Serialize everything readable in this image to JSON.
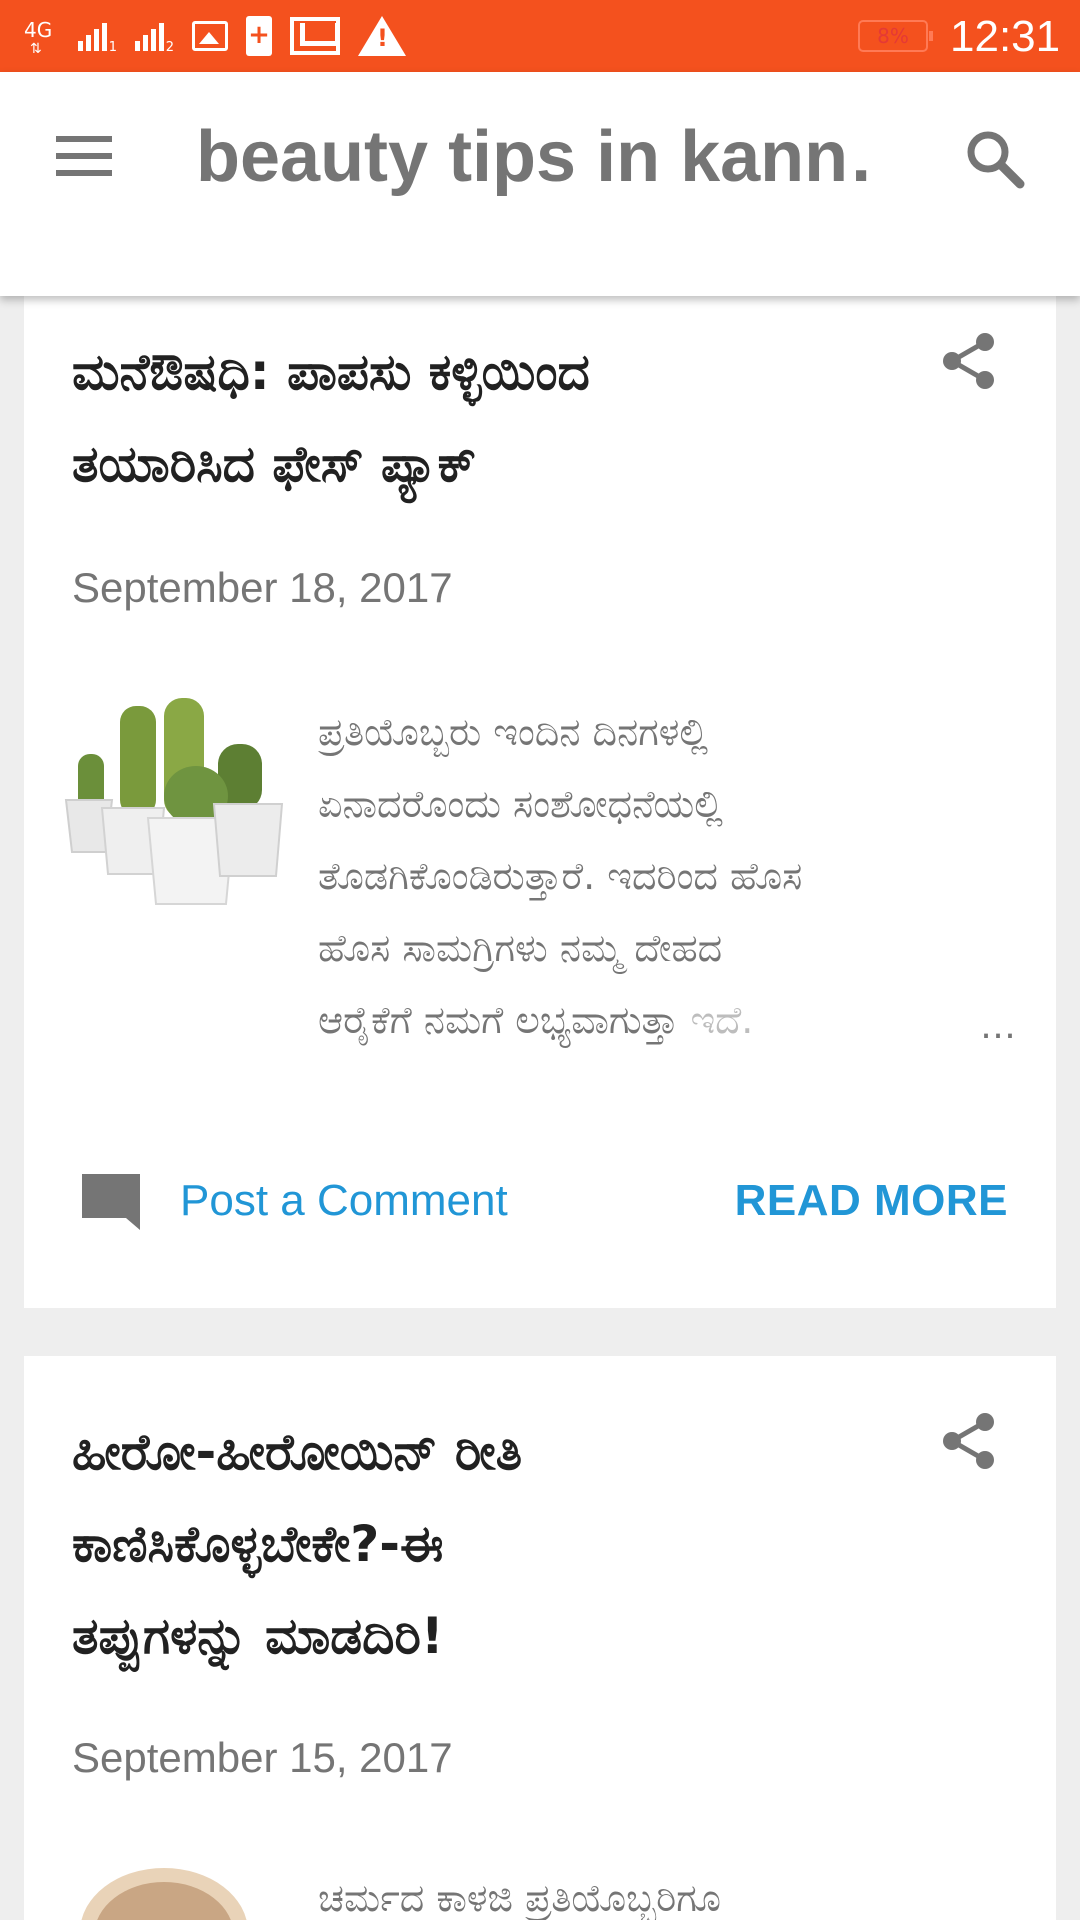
{
  "status_bar": {
    "network": "4G",
    "sim1": "1",
    "sim2": "2",
    "battery": "8%",
    "time": "12:31",
    "icons": [
      "network-4g-icon",
      "signal-sim1-icon",
      "signal-sim2-icon",
      "image-notification-icon",
      "battery-saver-icon",
      "gmail-icon",
      "warning-icon"
    ]
  },
  "app_bar": {
    "title": "beauty tips in kann…",
    "menu_icon": "hamburger-menu-icon",
    "search_icon": "search-icon"
  },
  "posts": [
    {
      "title_line1": "ಮನೆಔಷಧಿ: ಪಾಪಸು ಕಳ್ಳಿಯಿಂದ",
      "title_line2": "ತಯಾರಿಸಿದ ಫೇಸ್ ಪ್ಯಾಕ್",
      "date": "September 18, 2017",
      "thumbnail": "cactus-plants-image",
      "snippet_lines": [
        "ಪ್ರತಿಯೊಬ್ಬರು ಇಂದಿನ ದಿನಗಳಲ್ಲಿ",
        "ಏನಾದರೊಂದು ಸಂಶೋಧನೆಯಲ್ಲಿ",
        "ತೊಡಗಿಕೊಂಡಿರುತ್ತಾರೆ. ಇದರಿಂದ ಹೊಸ",
        "ಹೊಸ ಸಾಮಗ್ರಿಗಳು ನಮ್ಮ ದೇಹದ",
        "ಆರೈಕೆಗೆ ನಮಗೆ ಲಭ್ಯವಾಗುತ್ತಾ"
      ],
      "snippet_fade": "ಇದೆ.",
      "ellipsis": "…",
      "comment_label": "Post a Comment",
      "read_more": "READ MORE"
    },
    {
      "title_line1": "ಹೀರೋ-ಹೀರೋಯಿನ್ ರೀತಿ",
      "title_line2": "ಕಾಣಿಸಿಕೊಳ್ಳಬೇಕೇ?-ಈ",
      "title_line3": "ತಪ್ಪುಗಳನ್ನು ಮಾಡದಿರಿ!",
      "date": "September 15, 2017",
      "snippet_line1": "ಚರ್ಮದ ಕಾಳಜಿ ಪ್ರತಿಯೊಬ್ಬರಿಗೂ"
    }
  ],
  "colors": {
    "status_bar": "#f4511e",
    "link_blue": "#2196d6",
    "title_text": "#212121",
    "secondary_text": "#757575",
    "page_bg": "#eeeeee"
  }
}
